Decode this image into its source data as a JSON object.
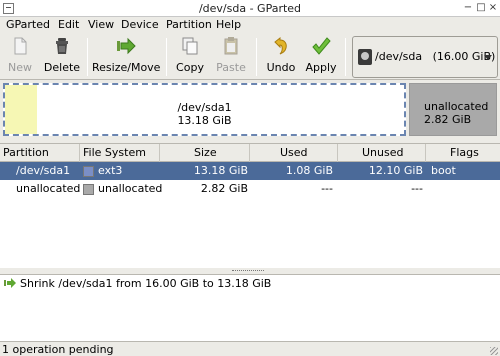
{
  "window": {
    "title": "/dev/sda - GParted"
  },
  "menu": [
    "GParted",
    "Edit",
    "View",
    "Device",
    "Partition",
    "Help"
  ],
  "toolbar": {
    "new": "New",
    "delete": "Delete",
    "resize": "Resize/Move",
    "copy": "Copy",
    "paste": "Paste",
    "undo": "Undo",
    "apply": "Apply"
  },
  "device_selector": {
    "value": "/dev/sda   (16.00 GiB)"
  },
  "disk_map": {
    "partition": {
      "name": "/dev/sda1",
      "size": "13.18 GiB",
      "used_fraction": 0.08
    },
    "unallocated": {
      "name": "unallocated",
      "size": "2.82 GiB"
    }
  },
  "table": {
    "headers": [
      "Partition",
      "File System",
      "Size",
      "Used",
      "Unused",
      "Flags"
    ],
    "rows": [
      {
        "partition": "/dev/sda1",
        "fs": "ext3",
        "size": "13.18 GiB",
        "used": "1.08 GiB",
        "unused": "12.10 GiB",
        "flags": "boot",
        "swatch": "#7b8fc6",
        "selected": true
      },
      {
        "partition": "unallocated",
        "fs": "unallocated",
        "size": "2.82 GiB",
        "used": "---",
        "unused": "---",
        "flags": "",
        "swatch": "#a9a9a9",
        "selected": false
      }
    ]
  },
  "operations": [
    "Shrink /dev/sda1 from 16.00 GiB to 13.18 GiB"
  ],
  "status": "1 operation pending",
  "colors": {
    "selection": "#4b6a99",
    "ext3": "#7b8fc6",
    "unallocated": "#a9a9a9",
    "used_space": "#f6f7b4"
  }
}
